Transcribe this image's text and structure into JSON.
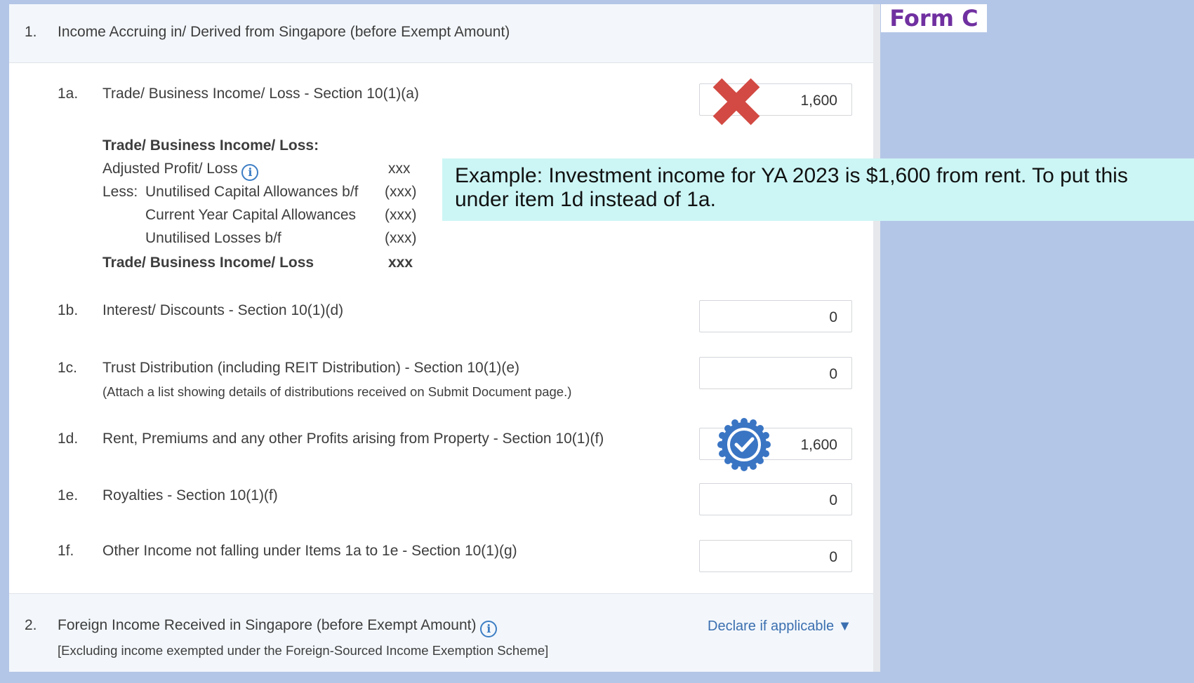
{
  "form_label": "Form C",
  "section1": {
    "num": "1.",
    "title": "Income Accruing in/ Derived from Singapore (before Exempt Amount)",
    "items": [
      {
        "code": "1a.",
        "label": "Trade/ Business Income/ Loss - Section 10(1)(a)",
        "value": "1,600",
        "note": ""
      },
      {
        "code": "1b.",
        "label": "Interest/ Discounts - Section 10(1)(d)",
        "value": "0",
        "note": ""
      },
      {
        "code": "1c.",
        "label": "Trust Distribution (including REIT Distribution) - Section 10(1)(e)",
        "value": "0",
        "note": "(Attach a list showing details of distributions received on Submit Document page.)"
      },
      {
        "code": "1d.",
        "label": "Rent, Premiums and any other Profits arising from Property - Section 10(1)(f)",
        "value": "1,600",
        "note": ""
      },
      {
        "code": "1e.",
        "label": "Royalties - Section 10(1)(f)",
        "value": "0",
        "note": ""
      },
      {
        "code": "1f.",
        "label": "Other Income not falling under Items 1a to 1e - Section 10(1)(g)",
        "value": "0",
        "note": ""
      }
    ],
    "breakdown": {
      "heading": "Trade/ Business Income/ Loss:",
      "adjusted_label": "Adjusted Profit/ Loss",
      "adjusted_value": "xxx",
      "less_label": "Less:",
      "lines": [
        {
          "label": "Unutilised Capital Allowances b/f",
          "value": "(xxx)"
        },
        {
          "label": "Current Year Capital Allowances",
          "value": "(xxx)"
        },
        {
          "label": "Unutilised Losses b/f",
          "value": "(xxx)"
        }
      ],
      "total_label": "Trade/ Business Income/ Loss",
      "total_value": "xxx"
    }
  },
  "section2": {
    "num": "2.",
    "title": "Foreign Income Received in Singapore (before Exempt Amount)",
    "note": "[Excluding income exempted under the Foreign-Sourced Income Exemption Scheme]",
    "declare_link": "Declare if applicable"
  },
  "callout_text": "Example: Investment income for YA 2023 is $1,600 from rent. To put this under item 1d instead of 1a.",
  "icons": {
    "info": "info-icon",
    "wrong": "red-x-icon",
    "correct": "blue-check-badge-icon",
    "dropdown": "triangle-down-icon"
  },
  "colors": {
    "background": "#b4c6e7",
    "callout": "#ccf6f5",
    "form_label": "#7030a0",
    "wrong_mark": "#d24a43",
    "correct_badge": "#3a75c4",
    "link": "#3b6fb0"
  }
}
